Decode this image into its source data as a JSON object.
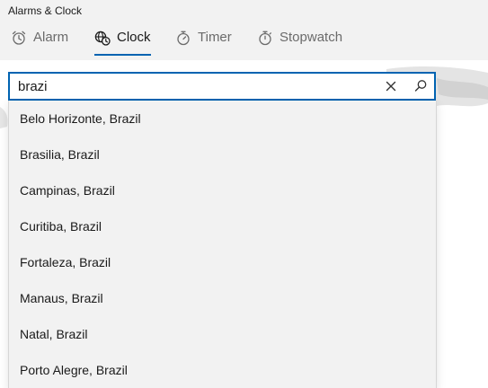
{
  "app": {
    "title": "Alarms & Clock"
  },
  "tabs": [
    {
      "label": "Alarm",
      "icon": "alarm-clock-icon",
      "active": false
    },
    {
      "label": "Clock",
      "icon": "world-clock-icon",
      "active": true
    },
    {
      "label": "Timer",
      "icon": "timer-icon",
      "active": false
    },
    {
      "label": "Stopwatch",
      "icon": "stopwatch-icon",
      "active": false
    }
  ],
  "search": {
    "value": "brazi",
    "clear_icon": "close-icon",
    "search_icon": "search-icon"
  },
  "suggestions": [
    "Belo Horizonte, Brazil",
    "Brasilia, Brazil",
    "Campinas, Brazil",
    "Curitiba, Brazil",
    "Fortaleza, Brazil",
    "Manaus, Brazil",
    "Natal, Brazil",
    "Porto Alegre, Brazil"
  ],
  "colors": {
    "accent": "#0063b1",
    "chrome": "#f2f2f2",
    "dropdown": "#f2f2f2",
    "inactive_tab_text": "#6b6b6b"
  }
}
